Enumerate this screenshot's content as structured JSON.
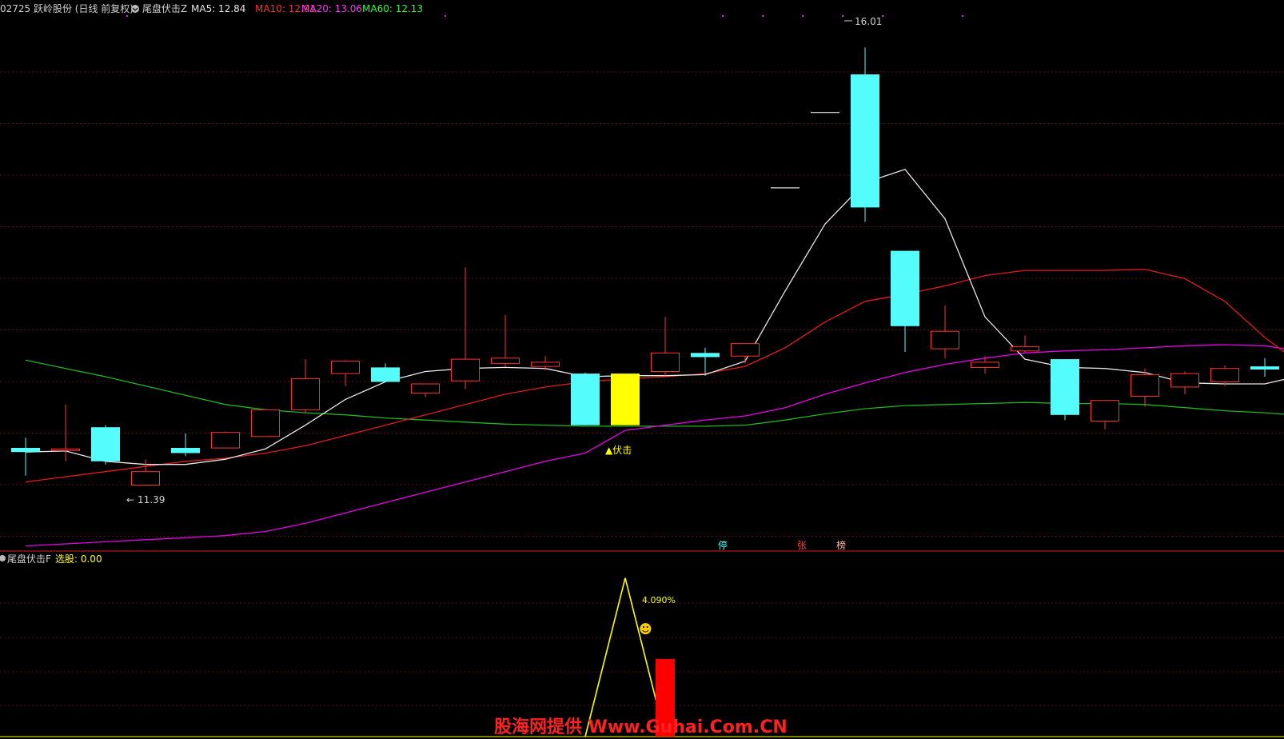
{
  "header": {
    "stock": "02725 跃岭股份 (日线 前复权)",
    "indicator_name": "尾盘伏击Z",
    "ma5": "MA5: 12.84",
    "ma10": "MA10: 12.91",
    "ma20": "MA20: 13.06",
    "ma60": "MA60: 12.13"
  },
  "sub_header": {
    "name": "尾盘伏击F",
    "value": "选股: 0.00"
  },
  "annotations": {
    "high_label": "16.01",
    "low_label": "11.39",
    "signal_label": "▲伏击",
    "percent_label": "4.090%",
    "smiley": "☻",
    "markers": [
      "停",
      "张",
      "榜"
    ]
  },
  "watermark": "股海网提供 Www.Guhai.Com.CN",
  "colors": {
    "background": "#000000",
    "up": "#ff3232",
    "down": "#54fcfc",
    "signal": "#ffff00",
    "ma5": "#e6e6e6",
    "ma10": "#e31a1a",
    "ma20": "#e600e6",
    "ma60": "#1fb51f",
    "grid": "#7a1515"
  },
  "chart_data": {
    "type": "candlestick",
    "title": "02725 跃岭股份 (日线 前复权)",
    "y_range": [
      11.2,
      16.3
    ],
    "candles": [
      {
        "open": 12.13,
        "close": 12.09,
        "high": 12.23,
        "low": 11.86
      },
      {
        "open": 12.12,
        "close": 12.12,
        "high": 12.55,
        "low": 12.0
      },
      {
        "open": 12.33,
        "close": 12.0,
        "high": 12.35,
        "low": 11.97
      },
      {
        "open": 11.77,
        "close": 11.9,
        "high": 12.02,
        "low": 11.77
      },
      {
        "open": 12.13,
        "close": 12.08,
        "high": 12.27,
        "low": 12.05
      },
      {
        "open": 12.13,
        "close": 12.28,
        "high": 12.29,
        "low": 12.13
      },
      {
        "open": 12.24,
        "close": 12.5,
        "high": 12.5,
        "low": 12.24
      },
      {
        "open": 12.5,
        "close": 12.8,
        "high": 12.99,
        "low": 12.47
      },
      {
        "open": 12.85,
        "close": 12.97,
        "high": 12.98,
        "low": 12.73
      },
      {
        "open": 12.91,
        "close": 12.77,
        "high": 12.95,
        "low": 12.77
      },
      {
        "open": 12.66,
        "close": 12.75,
        "high": 12.75,
        "low": 12.62
      },
      {
        "open": 12.78,
        "close": 12.99,
        "high": 13.88,
        "low": 12.7
      },
      {
        "open": 12.95,
        "close": 13.0,
        "high": 13.42,
        "low": 12.92
      },
      {
        "open": 12.92,
        "close": 12.96,
        "high": 13.02,
        "low": 12.88
      },
      {
        "open": 12.85,
        "close": 12.35,
        "high": 12.86,
        "low": 12.35
      },
      {
        "open": 12.35,
        "close": 12.85,
        "high": 12.85,
        "low": 12.35
      },
      {
        "open": 12.87,
        "close": 13.05,
        "high": 13.4,
        "low": 12.83
      },
      {
        "open": 13.05,
        "close": 13.01,
        "high": 13.1,
        "low": 12.83
      },
      {
        "open": 13.02,
        "close": 13.14,
        "high": 13.14,
        "low": 12.95
      },
      {
        "open": 14.65,
        "close": 14.65,
        "high": 14.65,
        "low": 14.65
      },
      {
        "open": 15.38,
        "close": 15.38,
        "high": 15.38,
        "low": 15.38
      },
      {
        "open": 15.75,
        "close": 14.46,
        "high": 16.01,
        "low": 14.32
      },
      {
        "open": 14.04,
        "close": 13.31,
        "high": 14.04,
        "low": 13.06
      },
      {
        "open": 13.09,
        "close": 13.26,
        "high": 13.51,
        "low": 13.0
      },
      {
        "open": 12.91,
        "close": 12.96,
        "high": 13.02,
        "low": 12.85
      },
      {
        "open": 13.07,
        "close": 13.11,
        "high": 13.22,
        "low": 13.06
      },
      {
        "open": 12.99,
        "close": 12.45,
        "high": 12.99,
        "low": 12.4
      },
      {
        "open": 12.39,
        "close": 12.59,
        "high": 12.59,
        "low": 12.31
      },
      {
        "open": 12.63,
        "close": 12.84,
        "high": 12.9,
        "low": 12.53
      },
      {
        "open": 12.72,
        "close": 12.85,
        "high": 12.87,
        "low": 12.65
      },
      {
        "open": 12.77,
        "close": 12.9,
        "high": 12.93,
        "low": 12.73
      },
      {
        "open": 12.92,
        "close": 12.89,
        "high": 13.0,
        "low": 12.82
      },
      {
        "open": 12.78,
        "close": 12.46,
        "high": 12.8,
        "low": 12.46
      }
    ],
    "markers_days": [
      18,
      20,
      21
    ],
    "signal_day": 15,
    "ma5": [
      12.09,
      12.1,
      12.0,
      11.97,
      11.97,
      12.02,
      12.12,
      12.35,
      12.6,
      12.77,
      12.87,
      12.9,
      12.91,
      12.9,
      12.82,
      12.83,
      12.83,
      12.84,
      12.97,
      13.65,
      14.3,
      14.7,
      14.83,
      14.35,
      13.4,
      12.99,
      12.91,
      12.9,
      12.86,
      12.76,
      12.75,
      12.75,
      12.84
    ],
    "ma10": [
      11.8,
      11.85,
      11.9,
      11.95,
      12.0,
      12.03,
      12.08,
      12.15,
      12.25,
      12.35,
      12.45,
      12.55,
      12.65,
      12.72,
      12.77,
      12.8,
      12.82,
      12.85,
      12.92,
      13.1,
      13.35,
      13.55,
      13.62,
      13.7,
      13.8,
      13.85,
      13.85,
      13.85,
      13.86,
      13.77,
      13.55,
      13.2,
      12.91
    ],
    "ma20": [
      11.18,
      11.2,
      11.22,
      11.24,
      11.26,
      11.28,
      11.32,
      11.4,
      11.5,
      11.6,
      11.7,
      11.8,
      11.9,
      12.0,
      12.08,
      12.3,
      12.35,
      12.4,
      12.44,
      12.52,
      12.65,
      12.76,
      12.86,
      12.94,
      13.0,
      13.05,
      13.07,
      13.08,
      13.1,
      13.12,
      13.13,
      13.12,
      13.06
    ],
    "ma60": [
      12.98,
      12.9,
      12.82,
      12.73,
      12.64,
      12.55,
      12.5,
      12.47,
      12.45,
      12.42,
      12.4,
      12.38,
      12.36,
      12.35,
      12.34,
      12.34,
      12.34,
      12.34,
      12.35,
      12.4,
      12.46,
      12.51,
      12.54,
      12.55,
      12.56,
      12.57,
      12.56,
      12.56,
      12.55,
      12.52,
      12.49,
      12.47,
      12.44
    ],
    "sub": {
      "y_range": [
        0,
        5
      ],
      "line": [
        0,
        0,
        0,
        0,
        0,
        0,
        0,
        0,
        0,
        0,
        0,
        0,
        0,
        0,
        0,
        4.7,
        0,
        0,
        0,
        0,
        0,
        0,
        0,
        0,
        0,
        0,
        0,
        0,
        0,
        0,
        0,
        0,
        0
      ],
      "bar_day": 16,
      "bar_value": 2.3
    }
  }
}
